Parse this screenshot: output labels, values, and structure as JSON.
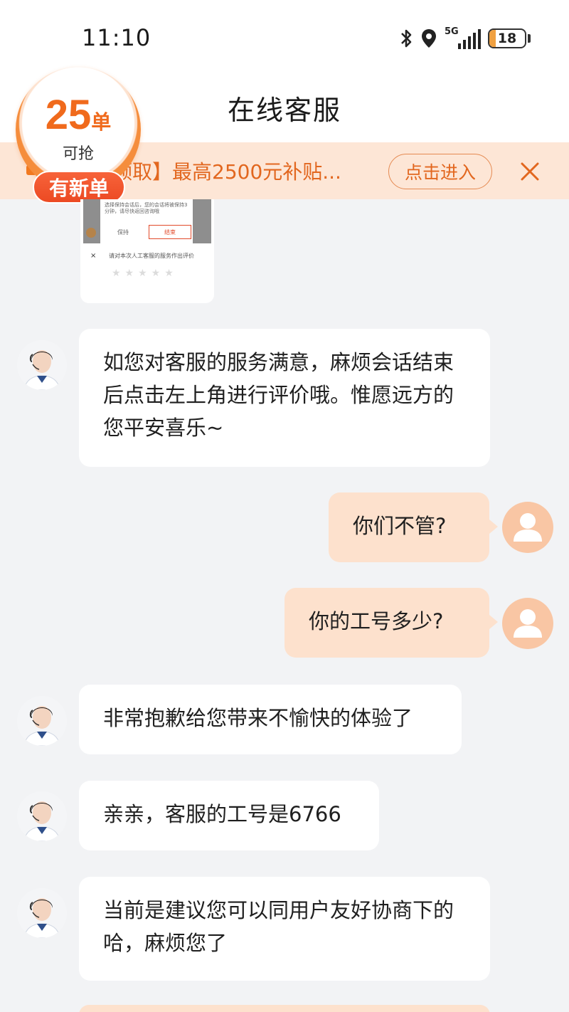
{
  "status_bar": {
    "time": "11:10",
    "network": "5G",
    "battery": "18"
  },
  "header": {
    "title": "在线客服"
  },
  "badge": {
    "count": "25",
    "unit": "单",
    "sub": "可抢",
    "pill": "有新单"
  },
  "banner": {
    "text": "领取】最高2500元补贴...",
    "button": "点击进入",
    "close": "×"
  },
  "thumbnail": {
    "dialog_text": "选择保持会话后，您的会话将被保持3分钟，请尽快返回咨询哦",
    "keep_label": "保持",
    "end_label": "结束",
    "rate_prompt": "请对本次人工客服的服务作出评价",
    "stars": "★★★★★",
    "close": "×"
  },
  "messages": [
    {
      "side": "in",
      "text": "如您对客服的服务满意，麻烦会话结束后点击左上角进行评价哦。惟愿远方的您平安喜乐~"
    },
    {
      "side": "out",
      "text": "你们不管?"
    },
    {
      "side": "out",
      "text": "你的工号多少?"
    },
    {
      "side": "in",
      "text": "非常抱歉给您带来不愉快的体验了"
    },
    {
      "side": "in",
      "text": "亲亲，客服的工号是6766"
    },
    {
      "side": "in",
      "text": "当前是建议您可以同用户友好协商下的哈，麻烦您了"
    }
  ],
  "colors": {
    "accent": "#e2671f",
    "banner_bg": "#fde6d6",
    "user_bubble": "#fde1cd",
    "page_bg": "#f2f3f5"
  },
  "icons": [
    "bluetooth-icon",
    "location-icon",
    "signal-icon",
    "battery-icon",
    "close-icon",
    "user-avatar-icon",
    "agent-avatar"
  ]
}
